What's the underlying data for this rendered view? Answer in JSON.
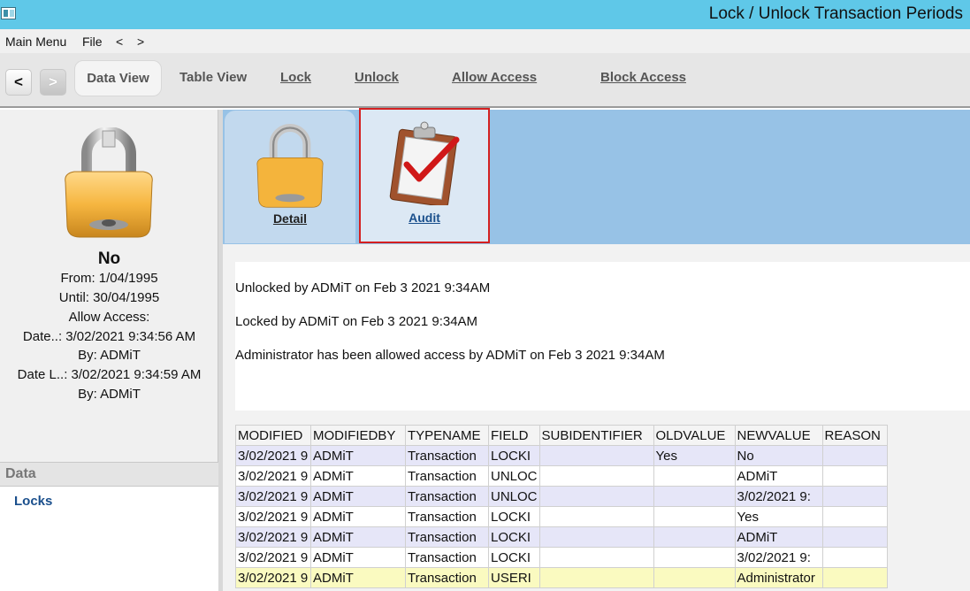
{
  "window": {
    "title": "Lock / Unlock Transaction Periods"
  },
  "menu": {
    "items": [
      "Main Menu",
      "File",
      "<",
      ">"
    ]
  },
  "toolbar": {
    "back": "<",
    "forward": ">",
    "data_view": "Data View",
    "table_view": "Table View",
    "lock": "Lock",
    "unlock": "Unlock",
    "allow_access": "Allow Access",
    "block_access": "Block Access"
  },
  "left": {
    "status": "No",
    "from": "From: 1/04/1995",
    "until": "Until: 30/04/1995",
    "allow_access": "Allow Access:",
    "date_a": "Date..: 3/02/2021 9:34:56 AM",
    "by_a": "By: ADMiT",
    "date_l": "Date L..: 3/02/2021 9:34:59 AM",
    "by_l": "By: ADMiT",
    "section_title": "Data",
    "locks_link": "Locks"
  },
  "tabs": {
    "detail": "Detail",
    "audit": "Audit"
  },
  "audit": {
    "lines": [
      "Unlocked by ADMiT on Feb  3 2021  9:34AM",
      "Locked by ADMiT on Feb  3 2021  9:34AM",
      "Administrator has been allowed access by ADMiT on Feb  3 2021  9:34AM"
    ]
  },
  "grid": {
    "columns": [
      "MODIFIED",
      "MODIFIEDBY",
      "TYPENAME",
      "FIELD",
      "SUBIDENTIFIER",
      "OLDVALUE",
      "NEWVALUE",
      "REASON"
    ],
    "rows": [
      [
        "3/02/2021 9",
        "ADMiT",
        "Transaction",
        "LOCKI",
        "",
        "Yes",
        "No",
        ""
      ],
      [
        "3/02/2021 9",
        "ADMiT",
        "Transaction",
        "UNLOC",
        "",
        "",
        "ADMiT",
        ""
      ],
      [
        "3/02/2021 9",
        "ADMiT",
        "Transaction",
        "UNLOC",
        "",
        "",
        "3/02/2021 9:",
        ""
      ],
      [
        "3/02/2021 9",
        "ADMiT",
        "Transaction",
        "LOCKI",
        "",
        "",
        "Yes",
        ""
      ],
      [
        "3/02/2021 9",
        "ADMiT",
        "Transaction",
        "LOCKI",
        "",
        "",
        "ADMiT",
        ""
      ],
      [
        "3/02/2021 9",
        "ADMiT",
        "Transaction",
        "LOCKI",
        "",
        "",
        "3/02/2021 9:",
        ""
      ],
      [
        "3/02/2021 9",
        "ADMiT",
        "Transaction",
        "USERI",
        "",
        "",
        "Administrator",
        ""
      ]
    ]
  },
  "colors": {
    "titlebar": "#5fc8e8",
    "tabstrip": "#97c2e6",
    "highlight": "#d42020",
    "link": "#1a4f8c"
  }
}
